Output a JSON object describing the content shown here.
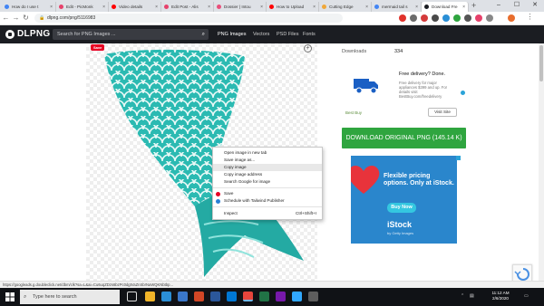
{
  "tabs": [
    {
      "label": "How do I use t",
      "color": "#4285f4"
    },
    {
      "label": "Edit - PicMonk",
      "color": "#e6416b"
    },
    {
      "label": "Video details",
      "color": "#ff0000"
    },
    {
      "label": "Edit Post - Alis",
      "color": "#e6416b"
    },
    {
      "label": "Dossier | Intou",
      "color": "#e94f7a"
    },
    {
      "label": "How to Upload",
      "color": "#ff0000"
    },
    {
      "label": "Cutting Edge",
      "color": "#f0a83a"
    },
    {
      "label": "mermaid tail s",
      "color": "#4285f4"
    },
    {
      "label": "Download Fre",
      "color": "#1b1d22"
    }
  ],
  "browser": {
    "url": "dlpng.com/png/5116983",
    "new_tab": "+",
    "min": "–",
    "max": "☐",
    "close": "✕"
  },
  "site": {
    "logo": "DLPNG",
    "search_placeholder": "Search for PNG Images ...",
    "nav": [
      "PNG Images",
      "Vectors",
      "PSD Files",
      "Fonts"
    ]
  },
  "image": {
    "save_badge": "Save",
    "tail_color": "#29b8b0"
  },
  "context_menu": {
    "items": [
      {
        "label": "Open image in new tab",
        "shortcut": ""
      },
      {
        "label": "Save image as...",
        "shortcut": ""
      },
      {
        "label": "Copy image",
        "shortcut": ""
      },
      {
        "label": "Copy image address",
        "shortcut": ""
      },
      {
        "label": "Search Google for image",
        "shortcut": ""
      },
      {
        "label": "Save",
        "shortcut": ""
      },
      {
        "label": "Schedule with Tailwind Publisher",
        "shortcut": ""
      },
      {
        "label": "Inspect",
        "shortcut": "Ctrl+Shift+I"
      }
    ],
    "highlighted": "Copy image"
  },
  "sidebar": {
    "downloads_label": "Downloads",
    "downloads_count": "334",
    "ad": {
      "title": "Free delivery? Done.",
      "text": "Free delivery for major appliances $399 and up. For details visit BestBuy.com/freedelivery",
      "brand": "Best Buy",
      "visit": "Visit Site"
    },
    "download_button": "DOWNLOAD ORIGINAL PNG (145.14 K)",
    "istock": {
      "headline": "Flexible pricing options. Only at iStock.",
      "cta": "Buy Now",
      "brand": "iStock",
      "sub": "by Getty Images"
    }
  },
  "status_bar": "https://googleads.g.doubleclick.net/dbm/clk?sa=L&ai=Cu6uqZDzs6bzPc0dgtVaZnSbrNaWQKNbtbp...",
  "taskbar": {
    "search": "Type here to search",
    "time": "11:12 AM",
    "date": "2/6/2020"
  }
}
